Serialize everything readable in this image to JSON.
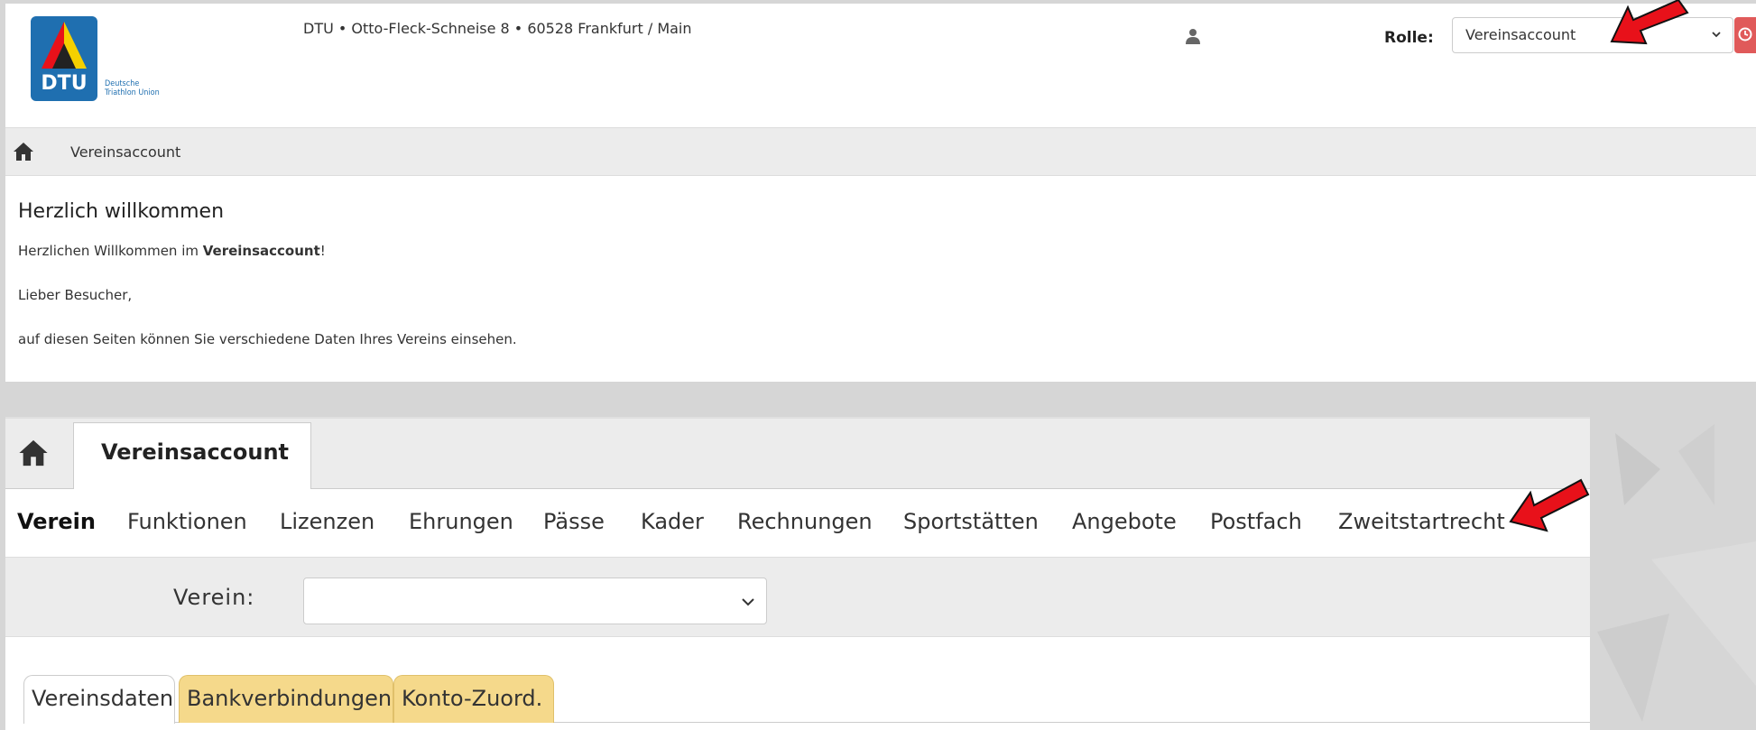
{
  "header": {
    "logo": {
      "name": "DTU",
      "subtitle_line1": "Deutsche",
      "subtitle_line2": "Triathlon Union"
    },
    "address": "DTU • Otto-Fleck-Schneise 8 • 60528 Frankfurt / Main",
    "rolle_label": "Rolle:",
    "rolle_value": "Vereinsaccount"
  },
  "breadcrumb": {
    "current": "Vereinsaccount"
  },
  "welcome": {
    "title": "Herzlich willkommen",
    "line1_prefix": "Herzlichen Willkommen im ",
    "line1_bold": "Vereinsaccount",
    "line1_suffix": "!",
    "line2": "Lieber Besucher,",
    "line3": "auf diesen Seiten können Sie verschiedene Daten Ihres Vereins einsehen."
  },
  "lower": {
    "active_tab": "Vereinsaccount",
    "menu": [
      "Verein",
      "Funktionen",
      "Lizenzen",
      "Ehrungen",
      "Pässe",
      "Kader",
      "Rechnungen",
      "Sportstätten",
      "Angebote",
      "Postfach",
      "Zweitstartrecht"
    ],
    "verein_label": "Verein:",
    "verein_value": "",
    "subtabs": [
      "Vereinsdaten",
      "Bankverbindungen",
      "Konto-Zuord."
    ]
  },
  "colors": {
    "logo_blue": "#1f6fb0",
    "arrow_red": "#e8111a",
    "tab_yellow": "#f5d98b",
    "clock_red": "#e05a5a"
  }
}
